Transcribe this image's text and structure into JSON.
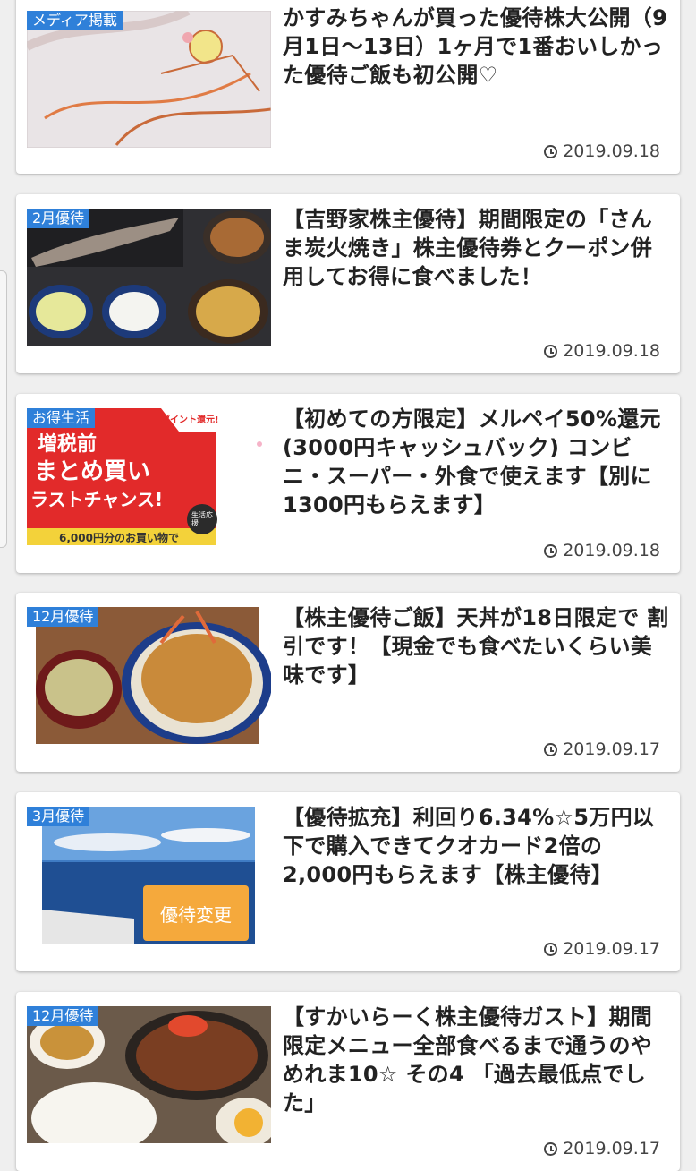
{
  "articles": [
    {
      "tag": "メディア掲載",
      "title": "かすみちゃんが買った優待株大公開（9月1日〜13日）1ヶ月で1番おいしかった優待ご飯も初公開♡",
      "date": "2019.09.18",
      "thumb_icon": "illustration-thumbnail"
    },
    {
      "tag": "2月優待",
      "title": "【吉野家株主優待】期間限定の「さんま炭火焼き」株主優待券とクーポン併用してお得に食べました！",
      "date": "2019.09.18",
      "thumb_icon": "sanma-meal-thumbnail"
    },
    {
      "tag": "お得生活",
      "title": "【初めての方限定】メルペイ50%還元 (3000円キャッシュバック) コンビニ・スーパー・外食で使えます【別に1300円もらえます】",
      "date": "2019.09.18",
      "thumb_icon": "campaign-banner-thumbnail",
      "banner": {
        "line1": "増税前",
        "line2": "まとめ買い",
        "line3": "ラストチャンス!",
        "badge": "ポイント還元!",
        "seal": "生活応援",
        "footer": "6,000円分のお買い物で"
      }
    },
    {
      "tag": "12月優待",
      "title": "【株主優待ご飯】天丼が18日限定で 割引です！【現金でも食べたいくらい美味です】",
      "date": "2019.09.17",
      "thumb_icon": "tendon-thumbnail"
    },
    {
      "tag": "3月優待",
      "title": "【優待拡充】利回り6.34%☆5万円以下で購入できてクオカード2倍の 2,000円もらえます【株主優待】",
      "date": "2019.09.17",
      "thumb_icon": "sea-view-thumbnail",
      "overlay": "優待変更"
    },
    {
      "tag": "12月優待",
      "title": "【すかいらーく株主優待ガスト】期間限定メニュー全部食べるまで通うのやめれま10☆ その4 「過去最低点でした」",
      "date": "2019.09.17",
      "thumb_icon": "gusto-meal-thumbnail"
    }
  ]
}
